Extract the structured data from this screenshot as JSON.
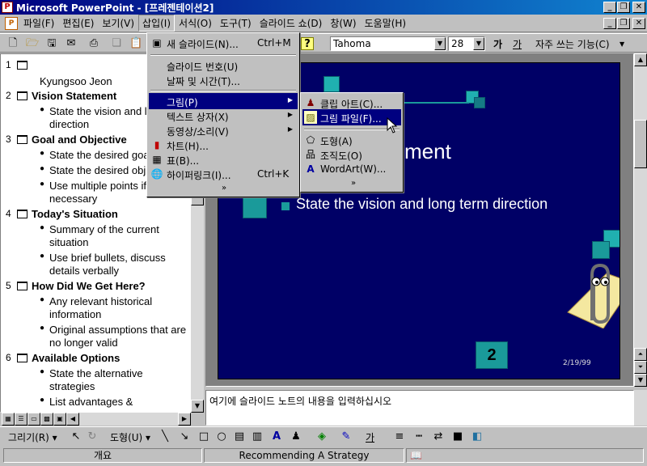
{
  "window": {
    "title": "Microsoft PowerPoint - [프레젠테이션2]",
    "app_icon": "P"
  },
  "menubar": {
    "items": [
      "파일(F)",
      "편집(E)",
      "보기(V)",
      "삽입(I)",
      "서식(O)",
      "도구(T)",
      "슬라이드 쇼(D)",
      "창(W)",
      "도움말(H)"
    ]
  },
  "toolbar": {
    "font_name": "Tahoma",
    "font_size": "28",
    "bold_glyph": "가",
    "underline_glyph": "가",
    "frequent_label": "자주 쓰는 기능(C)"
  },
  "insert_menu": {
    "items": [
      {
        "label": "새 슬라이드(N)...",
        "shortcut": "Ctrl+M",
        "icon": "new-slide-icon"
      },
      {
        "label": "슬라이드 번호(U)"
      },
      {
        "label": "날짜 및 시간(T)..."
      },
      {
        "label": "그림(P)",
        "submenu": true
      },
      {
        "label": "텍스트 상자(X)",
        "submenu": true
      },
      {
        "label": "동영상/소리(V)",
        "submenu": true
      },
      {
        "label": "차트(H)...",
        "icon": "chart-icon"
      },
      {
        "label": "표(B)...",
        "icon": "table-icon"
      },
      {
        "label": "하이퍼링크(I)...",
        "shortcut": "Ctrl+K",
        "icon": "globe-link-icon"
      }
    ],
    "more": "»"
  },
  "picture_submenu": {
    "items": [
      {
        "label": "클립 아트(C)...",
        "icon": "clipart-icon"
      },
      {
        "label": "그림 파일(F)...",
        "icon": "picture-file-icon"
      },
      {
        "label": "도형(A)",
        "icon": "shapes-icon"
      },
      {
        "label": "조직도(O)",
        "icon": "org-chart-icon"
      },
      {
        "label": "WordArt(W)...",
        "icon": "wordart-icon"
      }
    ],
    "more": "»"
  },
  "outline": {
    "slides": [
      {
        "num": "1",
        "title": "",
        "sub": "Kyungsoo Jeon",
        "bullets": []
      },
      {
        "num": "2",
        "title": "Vision Statement",
        "bullets": [
          [
            "State the vision and l",
            "direction"
          ]
        ]
      },
      {
        "num": "3",
        "title": "Goal and Objective",
        "bullets": [
          [
            "State the desired goa"
          ],
          [
            "State the desired obj"
          ],
          [
            "Use multiple points if",
            "necessary"
          ]
        ]
      },
      {
        "num": "4",
        "title": "Today's Situation",
        "bullets": [
          [
            "Summary of the current",
            "situation"
          ],
          [
            "Use brief bullets, discuss",
            "details verbally"
          ]
        ]
      },
      {
        "num": "5",
        "title": "How Did We Get Here?",
        "bullets": [
          [
            "Any relevant historical",
            "information"
          ],
          [
            "Original assumptions that are",
            "no longer valid"
          ]
        ]
      },
      {
        "num": "6",
        "title": "Available Options",
        "bullets": [
          [
            "State the alternative",
            "strategies"
          ],
          [
            "List advantages &"
          ]
        ]
      }
    ]
  },
  "slide": {
    "title_fragment": "ment",
    "bullet": "State the vision and long term direction",
    "number": "2",
    "date": "2/19/99",
    "colors": {
      "background": "#000066",
      "accent": "#1a9a9a"
    }
  },
  "notes": {
    "placeholder": "여기에 슬라이드 노트의 내용을 입력하십시오"
  },
  "drawing_toolbar": {
    "draw_label": "그리기(R)",
    "autoshapes_label": "도형(U)",
    "font_color_glyph": "가"
  },
  "statusbar": {
    "layout": "개요",
    "template": "Recommending A Strategy"
  }
}
